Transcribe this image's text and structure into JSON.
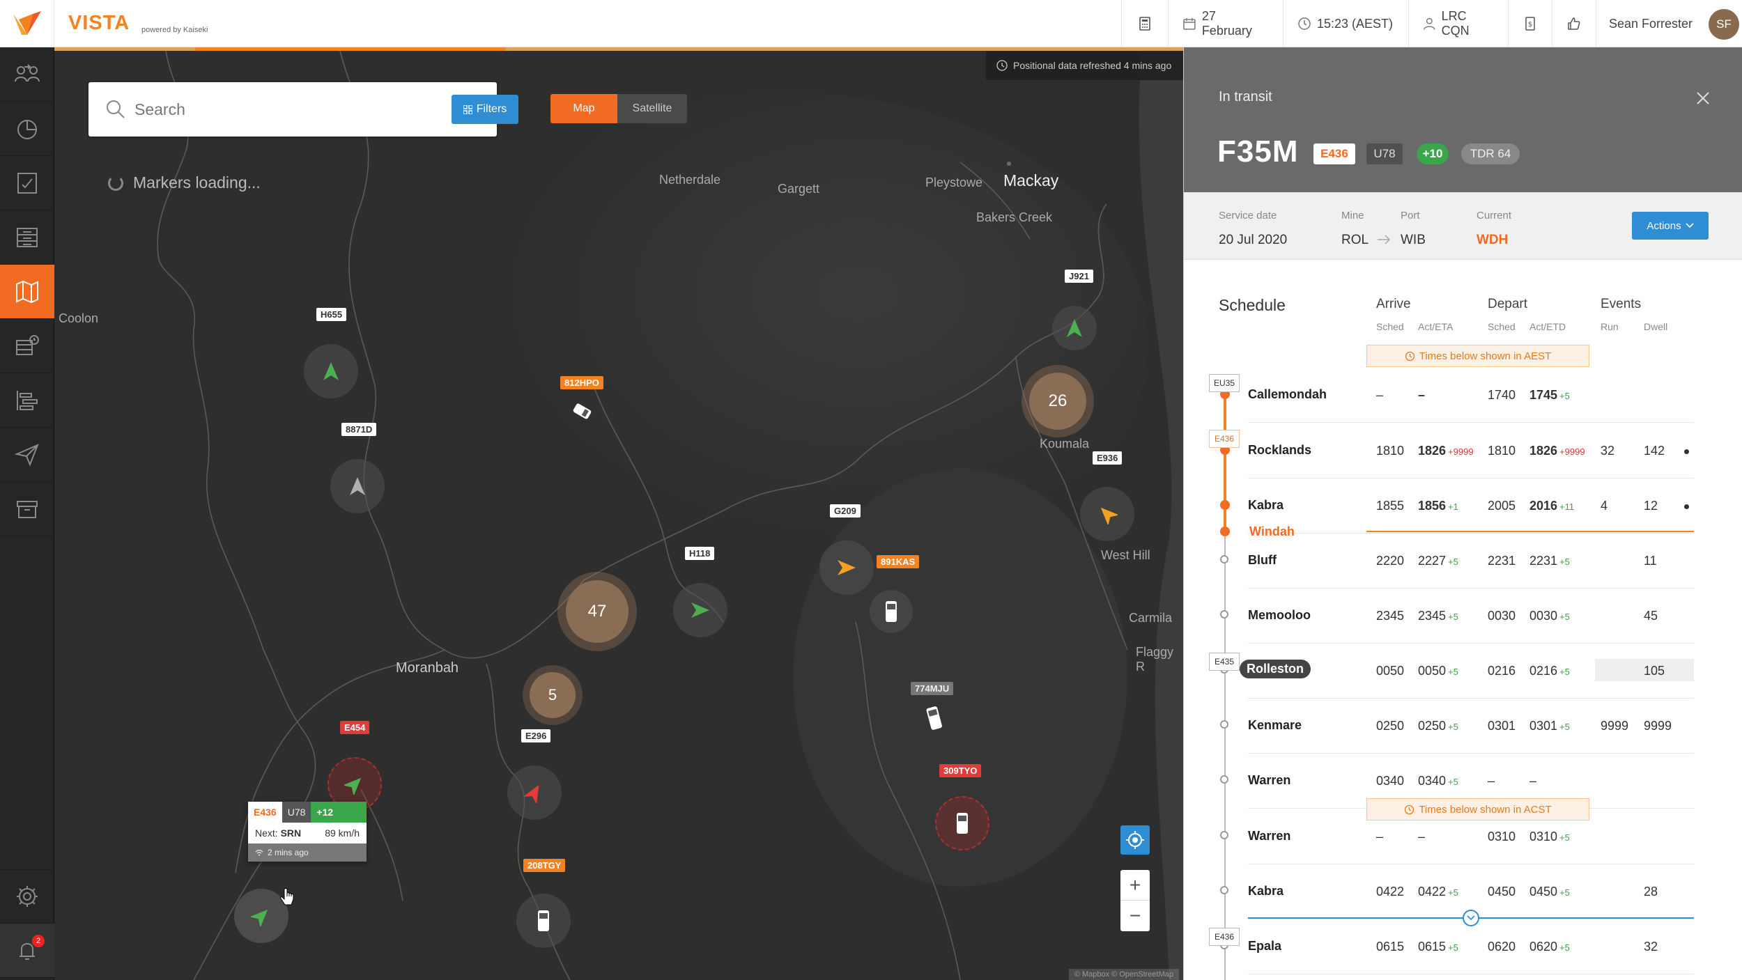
{
  "header": {
    "brand": "VISTA",
    "brand_sub": "powered by Kaiseki",
    "date": "27 February",
    "time": "15:23 (AEST)",
    "location": "LRC CQN",
    "user_name": "Sean Forrester",
    "user_initials": "SF"
  },
  "nav": {
    "notification_count": "2"
  },
  "map": {
    "search_placeholder": "Search",
    "filters_label": "Filters",
    "toggle_map": "Map",
    "toggle_satellite": "Satellite",
    "loading_text": "Markers loading...",
    "refresh_note": "Positional data refreshed 4 mins ago",
    "attribution": "© Mapbox © OpenStreetMap",
    "places": {
      "mackay": "Mackay",
      "netherdale": "Netherdale",
      "gargett": "Gargett",
      "pleystowe": "Pleystowe",
      "bakers_creek": "Bakers Creek",
      "coolon": "Coolon",
      "koumala": "Koumala",
      "west_hill": "West Hill",
      "carmila": "Carmila",
      "flaggy_rock": "Flaggy R",
      "moranbah": "Moranbah"
    },
    "clusters": {
      "c47": "47",
      "c26": "26",
      "c5": "5"
    },
    "vehicles": {
      "h655": "H655",
      "v8871d": "8871D",
      "v812hpo": "812HPO",
      "j921": "J921",
      "e936": "E936",
      "g209": "G209",
      "h118": "H118",
      "v891kas": "891KAS",
      "v774mju": "774MJU",
      "e454": "E454",
      "e296": "E296",
      "v309tyo": "309TYO",
      "v208tgy": "208TGY"
    },
    "tooltip": {
      "train": "E436",
      "unit": "U78",
      "delta": "+12",
      "next_label": "Next:",
      "next_station": "SRN",
      "speed": "89 km/h",
      "age": "2 mins ago"
    }
  },
  "panel": {
    "status": "In transit",
    "train_id": "F35M",
    "tags": {
      "service": "E436",
      "unit": "U78",
      "delay": "+10",
      "tdr": "TDR 64"
    },
    "service_date_label": "Service date",
    "service_date": "20 Jul 2020",
    "mine_label": "Mine",
    "mine": "ROL",
    "port_label": "Port",
    "port": "WIB",
    "current_label": "Current",
    "current": "WDH",
    "actions_label": "Actions",
    "schedule_title": "Schedule",
    "col_arrive": "Arrive",
    "col_depart": "Depart",
    "col_events": "Events",
    "sub_sched1": "Sched",
    "sub_act_eta": "Act/ETA",
    "sub_sched2": "Sched",
    "sub_act_etd": "Act/ETD",
    "sub_run": "Run",
    "sub_dwell": "Dwell",
    "tz_aest": "Times below shown in AEST",
    "tz_acst": "Times below shown in ACST",
    "current_stop": "Windah",
    "tl_tags": [
      "EU35",
      "E436",
      "E435",
      "E436"
    ],
    "rows": [
      {
        "station": "Callemondah",
        "arr_s": "–",
        "arr_a": "–",
        "arr_d": "",
        "dep_s": "1740",
        "dep_a": "1745",
        "dep_d": "+5",
        "run": "",
        "dwell": ""
      },
      {
        "station": "Rocklands",
        "arr_s": "1810",
        "arr_a": "1826",
        "arr_d": "+9999",
        "dep_s": "1810",
        "dep_a": "1826",
        "dep_d": "+9999",
        "run": "32",
        "dwell": "142"
      },
      {
        "station": "Kabra",
        "arr_s": "1855",
        "arr_a": "1856",
        "arr_d": "+1",
        "dep_s": "2005",
        "dep_a": "2016",
        "dep_d": "+11",
        "run": "4",
        "dwell": "12"
      },
      {
        "station": "Bluff",
        "arr_s": "2220",
        "arr_a": "2227",
        "arr_d": "+5",
        "dep_s": "2231",
        "dep_a": "2231",
        "dep_d": "+5",
        "run": "",
        "dwell": "11"
      },
      {
        "station": "Memooloo",
        "arr_s": "2345",
        "arr_a": "2345",
        "arr_d": "+5",
        "dep_s": "0030",
        "dep_a": "0030",
        "dep_d": "+5",
        "run": "",
        "dwell": "45"
      },
      {
        "station": "Rolleston",
        "arr_s": "0050",
        "arr_a": "0050",
        "arr_d": "+5",
        "dep_s": "0216",
        "dep_a": "0216",
        "dep_d": "+5",
        "run": "",
        "dwell": "105"
      },
      {
        "station": "Kenmare",
        "arr_s": "0250",
        "arr_a": "0250",
        "arr_d": "+5",
        "dep_s": "0301",
        "dep_a": "0301",
        "dep_d": "+5",
        "run": "9999",
        "dwell": "9999"
      },
      {
        "station": "Warren",
        "arr_s": "0340",
        "arr_a": "0340",
        "arr_d": "+5",
        "dep_s": "–",
        "dep_a": "–",
        "dep_d": "",
        "run": "",
        "dwell": ""
      },
      {
        "station": "Warren",
        "arr_s": "–",
        "arr_a": "–",
        "arr_d": "",
        "dep_s": "0310",
        "dep_a": "0310",
        "dep_d": "+5",
        "run": "",
        "dwell": ""
      },
      {
        "station": "Kabra",
        "arr_s": "0422",
        "arr_a": "0422",
        "arr_d": "+5",
        "dep_s": "0450",
        "dep_a": "0450",
        "dep_d": "+5",
        "run": "",
        "dwell": "28"
      },
      {
        "station": "Epala",
        "arr_s": "0615",
        "arr_a": "0615",
        "arr_d": "+5",
        "dep_s": "0620",
        "dep_a": "0620",
        "dep_d": "+5",
        "run": "",
        "dwell": "32"
      }
    ]
  },
  "colors": {
    "accent": "#f26b22",
    "blue": "#2f8dd3",
    "green": "#3aa64a",
    "red": "#e23b3b"
  }
}
